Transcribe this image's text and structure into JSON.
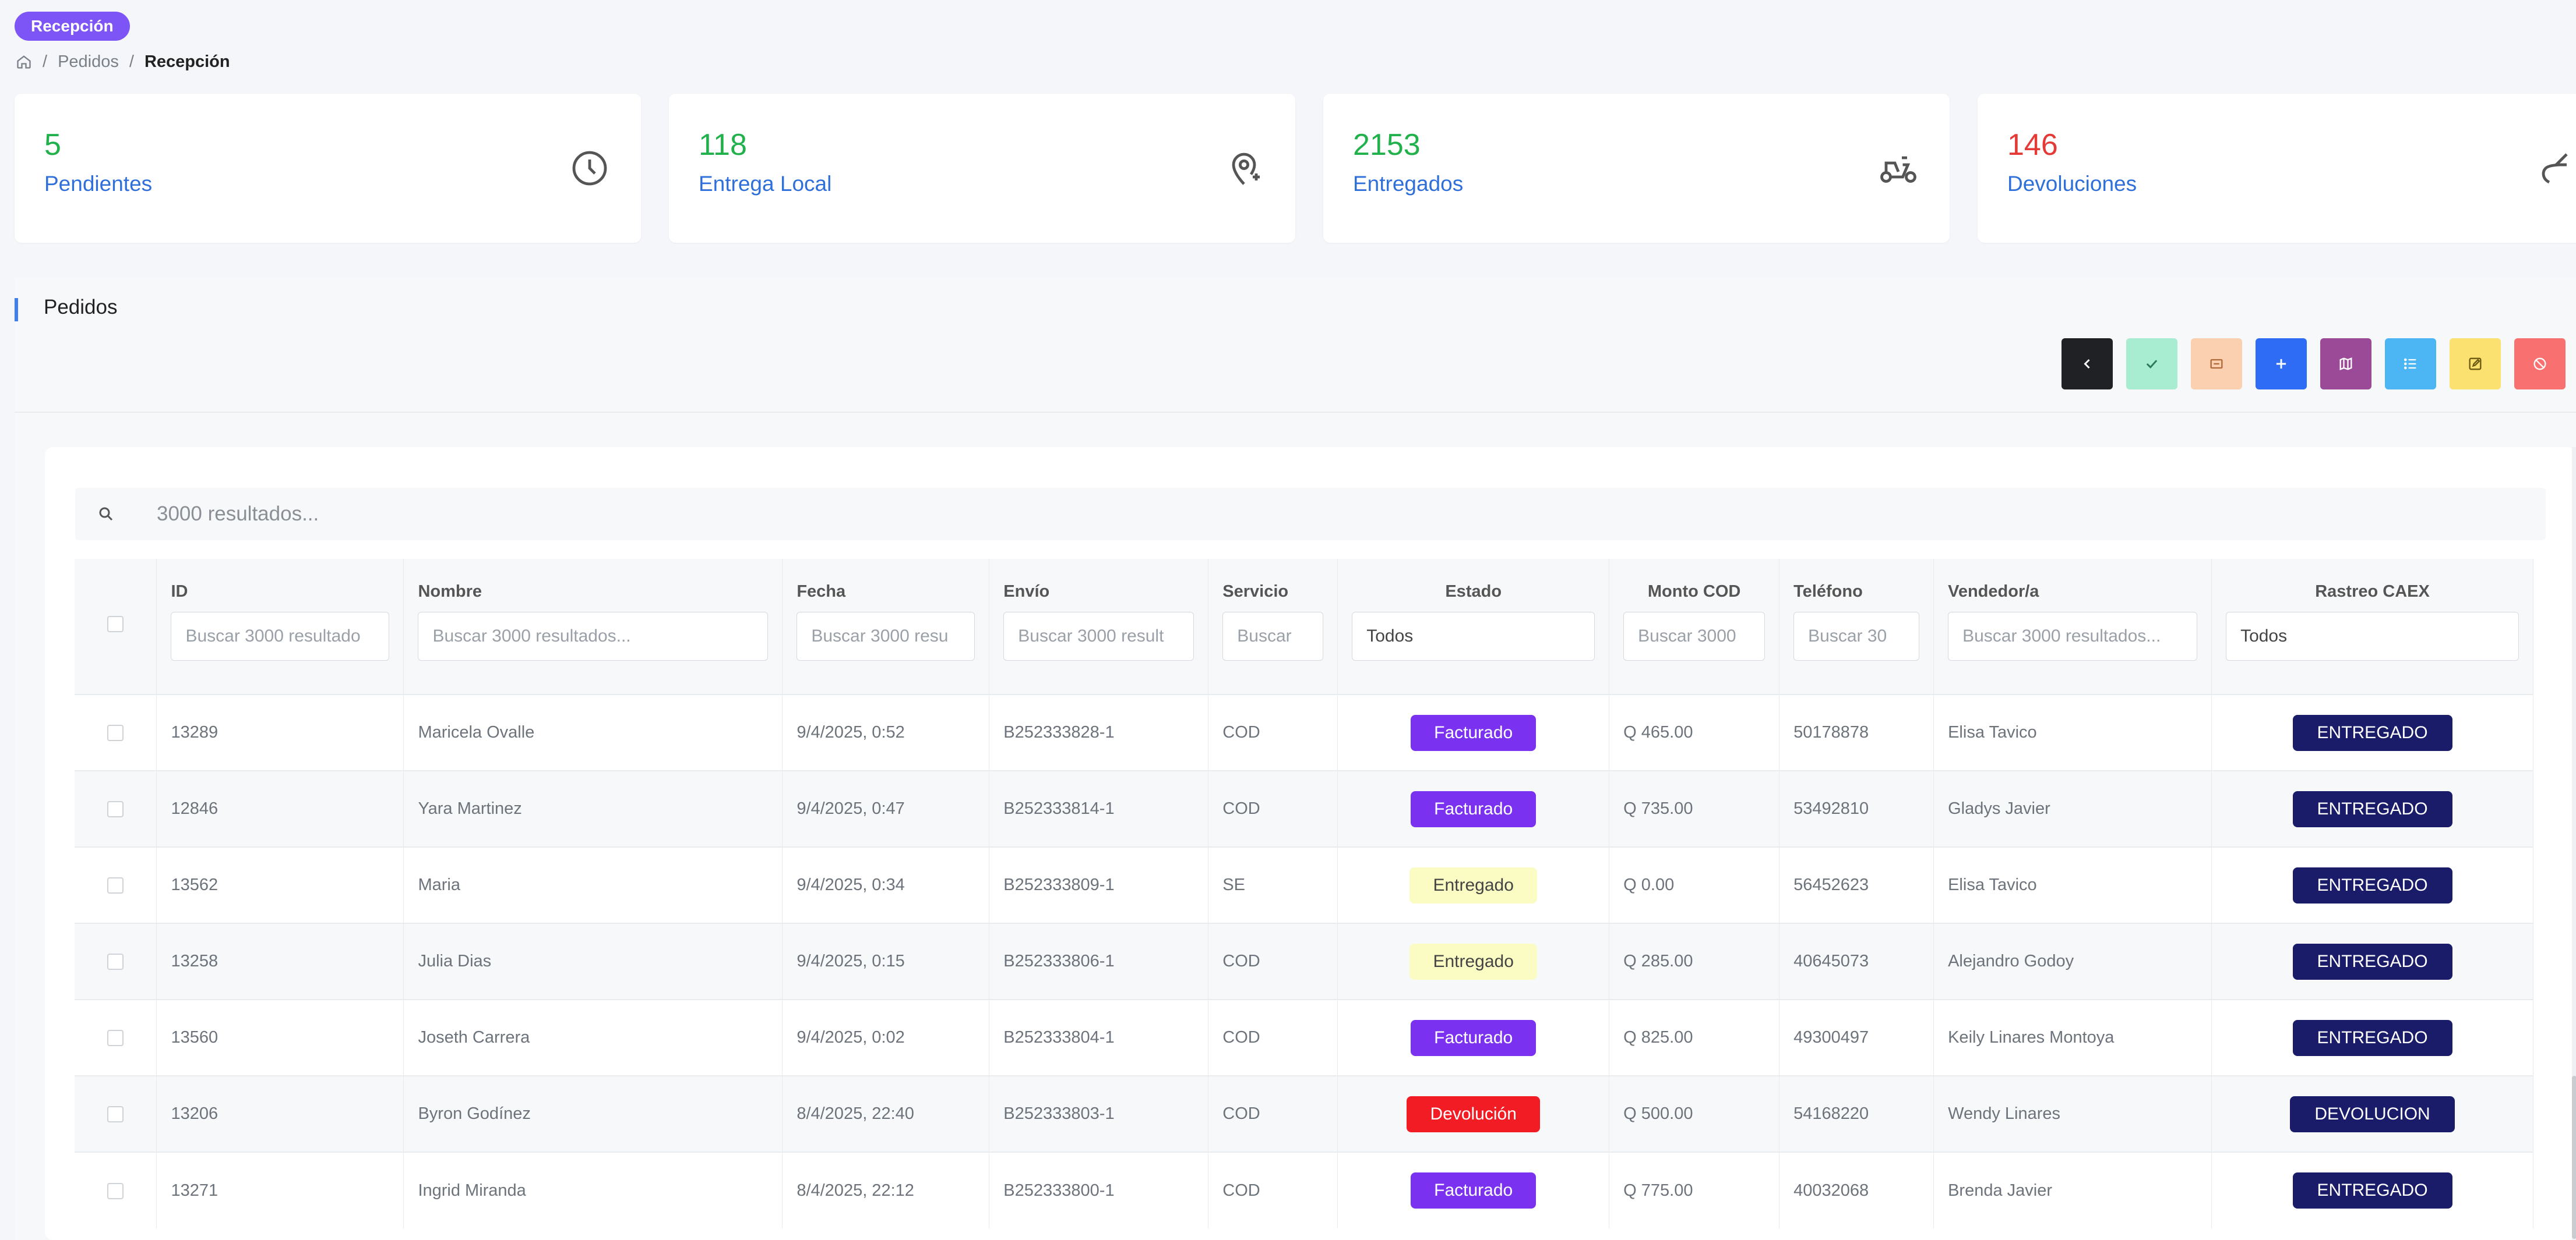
{
  "page_badge": "Recepción",
  "breadcrumb": {
    "items": [
      "Pedidos",
      "Recepción"
    ]
  },
  "cards": [
    {
      "value": "5",
      "label": "Pendientes",
      "color": "#21b14b",
      "icon": "clock-icon"
    },
    {
      "value": "118",
      "label": "Entrega Local",
      "color": "#21b14b",
      "icon": "map-pin-icon"
    },
    {
      "value": "2153",
      "label": "Entregados",
      "color": "#21b14b",
      "icon": "scooter-icon"
    },
    {
      "value": "146",
      "label": "Devoluciones",
      "color": "#e53935",
      "icon": "return-arrow-icon"
    }
  ],
  "panel": {
    "title": "Pedidos"
  },
  "toolbar": [
    {
      "icon": "chevron-left-icon",
      "color": "#1f2124"
    },
    {
      "icon": "check-icon",
      "color": "#a8ecd2"
    },
    {
      "icon": "ticket-icon",
      "color": "#fbd0b0"
    },
    {
      "icon": "plus-icon",
      "color": "#2f6cf5"
    },
    {
      "icon": "map-icon",
      "color": "#9b4a97"
    },
    {
      "icon": "list-icon",
      "color": "#4cb5f3"
    },
    {
      "icon": "edit-icon",
      "color": "#fbe170"
    },
    {
      "icon": "ban-icon",
      "color": "#f97070"
    }
  ],
  "search": {
    "placeholder": "3000 resultados..."
  },
  "table": {
    "headers": [
      "ID",
      "Nombre",
      "Fecha",
      "Envío",
      "Servicio",
      "Estado",
      "Monto COD",
      "Teléfono",
      "Vendedor/a",
      "Rastreo CAEX"
    ],
    "filters": [
      "Buscar 3000 resultado",
      "Buscar 3000 resultados...",
      "Buscar 3000 resu",
      "Buscar 3000 result",
      "Buscar",
      "Todos",
      "Buscar 3000",
      "Buscar 30",
      "Buscar 3000 resultados...",
      "Todos"
    ],
    "rows": [
      {
        "id": "13289",
        "nombre": "Maricela Ovalle",
        "fecha": "9/4/2025, 0:52",
        "envio": "B252333828-1",
        "servicio": "COD",
        "estado": "Facturado",
        "monto": "Q 465.00",
        "telefono": "50178878",
        "vendedor": "Elisa Tavico",
        "rastreo": "ENTREGADO"
      },
      {
        "id": "12846",
        "nombre": "Yara Martinez",
        "fecha": "9/4/2025, 0:47",
        "envio": "B252333814-1",
        "servicio": "COD",
        "estado": "Facturado",
        "monto": "Q 735.00",
        "telefono": "53492810",
        "vendedor": "Gladys Javier",
        "rastreo": "ENTREGADO"
      },
      {
        "id": "13562",
        "nombre": "Maria",
        "fecha": "9/4/2025, 0:34",
        "envio": "B252333809-1",
        "servicio": "SE",
        "estado": "Entregado",
        "monto": "Q 0.00",
        "telefono": "56452623",
        "vendedor": "Elisa Tavico",
        "rastreo": "ENTREGADO"
      },
      {
        "id": "13258",
        "nombre": "Julia Dias",
        "fecha": "9/4/2025, 0:15",
        "envio": "B252333806-1",
        "servicio": "COD",
        "estado": "Entregado",
        "monto": "Q 285.00",
        "telefono": "40645073",
        "vendedor": "Alejandro Godoy",
        "rastreo": "ENTREGADO"
      },
      {
        "id": "13560",
        "nombre": "Joseth Carrera",
        "fecha": "9/4/2025, 0:02",
        "envio": "B252333804-1",
        "servicio": "COD",
        "estado": "Facturado",
        "monto": "Q 825.00",
        "telefono": "49300497",
        "vendedor": "Keily Linares Montoya",
        "rastreo": "ENTREGADO"
      },
      {
        "id": "13206",
        "nombre": "Byron Godínez",
        "fecha": "8/4/2025, 22:40",
        "envio": "B252333803-1",
        "servicio": "COD",
        "estado": "Devolución",
        "monto": "Q 500.00",
        "telefono": "54168220",
        "vendedor": "Wendy Linares",
        "rastreo": "DEVOLUCION"
      },
      {
        "id": "13271",
        "nombre": "Ingrid Miranda",
        "fecha": "8/4/2025, 22:12",
        "envio": "B252333800-1",
        "servicio": "COD",
        "estado": "Facturado",
        "monto": "Q 775.00",
        "telefono": "40032068",
        "vendedor": "Brenda Javier",
        "rastreo": "ENTREGADO"
      }
    ]
  }
}
